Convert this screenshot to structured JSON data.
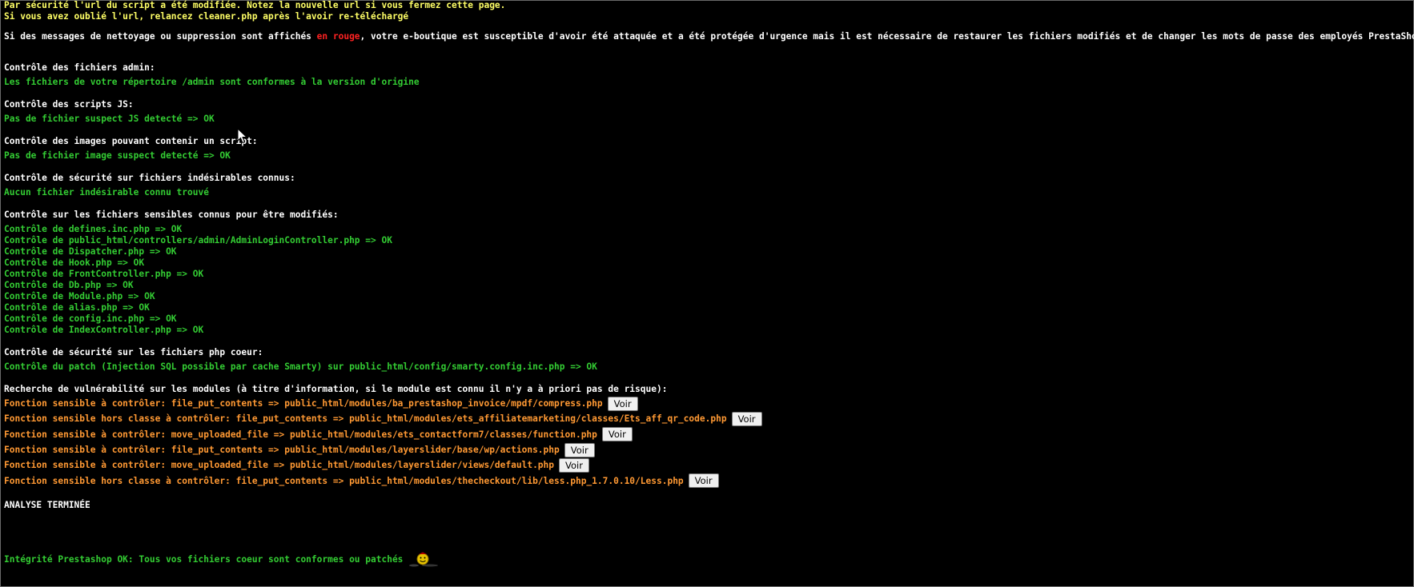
{
  "notice": {
    "line1": "Par sécurité l'url du script a été modifiée. Notez la nouvelle url si vous fermez cette page.",
    "line2": "Si vous avez oublié l'url, relancez cleaner.php après l'avoir re-téléchargé",
    "warning_before": "Si des messages de nettoyage ou suppression sont affichés ",
    "warning_red": "en rouge",
    "warning_after": ", votre e-boutique est susceptible d'avoir été attaquée et a été protégée d'urgence mais il est nécessaire de restaurer les fichiers modifiés et de changer les mots de passe des employés PrestaShop."
  },
  "sections": {
    "admin": {
      "title": "Contrôle des fichiers admin:",
      "result": "Les fichiers de votre répertoire /admin sont conformes à la version d'origine"
    },
    "js": {
      "title": "Contrôle des scripts JS:",
      "result": "Pas de fichier suspect JS detecté => OK"
    },
    "images": {
      "title": "Contrôle des images pouvant contenir un script:",
      "result": "Pas de fichier image suspect detecté => OK"
    },
    "unwanted": {
      "title": "Contrôle de sécurité sur fichiers indésirables connus:",
      "result": "Aucun fichier indésirable connu trouvé"
    },
    "sensitive": {
      "title": "Contrôle sur les fichiers sensibles connus pour être modifiés:",
      "items": [
        "Contrôle de defines.inc.php => OK",
        "Contrôle de public_html/controllers/admin/AdminLoginController.php => OK",
        "Contrôle de Dispatcher.php => OK",
        "Contrôle de Hook.php => OK",
        "Contrôle de FrontController.php => OK",
        "Contrôle de Db.php => OK",
        "Contrôle de Module.php => OK",
        "Contrôle de alias.php => OK",
        "Contrôle de config.inc.php => OK",
        "Contrôle de IndexController.php => OK"
      ]
    },
    "core": {
      "title": "Contrôle de sécurité sur les fichiers php coeur:",
      "result": "Contrôle du patch (Injection SQL possible par cache Smarty) sur public_html/config/smarty.config.inc.php => OK"
    },
    "modules": {
      "title": "Recherche de vulnérabilité sur les modules (à titre d'information, si le module est connu il n'y a à priori pas de risque):",
      "button_label": "Voir",
      "items": [
        "Fonction sensible à contrôler: file_put_contents => public_html/modules/ba_prestashop_invoice/mpdf/compress.php",
        "Fonction sensible hors classe à contrôler: file_put_contents => public_html/modules/ets_affiliatemarketing/classes/Ets_aff_qr_code.php",
        "Fonction sensible à contrôler: move_uploaded_file => public_html/modules/ets_contactform7/classes/function.php",
        "Fonction sensible à contrôler: file_put_contents => public_html/modules/layerslider/base/wp/actions.php",
        "Fonction sensible à contrôler: move_uploaded_file => public_html/modules/layerslider/views/default.php",
        "Fonction sensible hors classe à contrôler: file_put_contents => public_html/modules/thecheckout/lib/less.php_1.7.0.10/Less.php"
      ]
    }
  },
  "done": "ANALYSE TERMINÉE",
  "integrity": "Intégrité Prestashop OK: Tous vos fichiers coeur sont conformes ou patchés",
  "colors": {
    "background": "#000000",
    "notice": "#ffff66",
    "ok": "#33cc33",
    "module_warning": "#ff9933",
    "red": "#ff2222"
  },
  "icons": {
    "cursor": "mouse-pointer-icon",
    "smiley": "smiley-icon"
  }
}
